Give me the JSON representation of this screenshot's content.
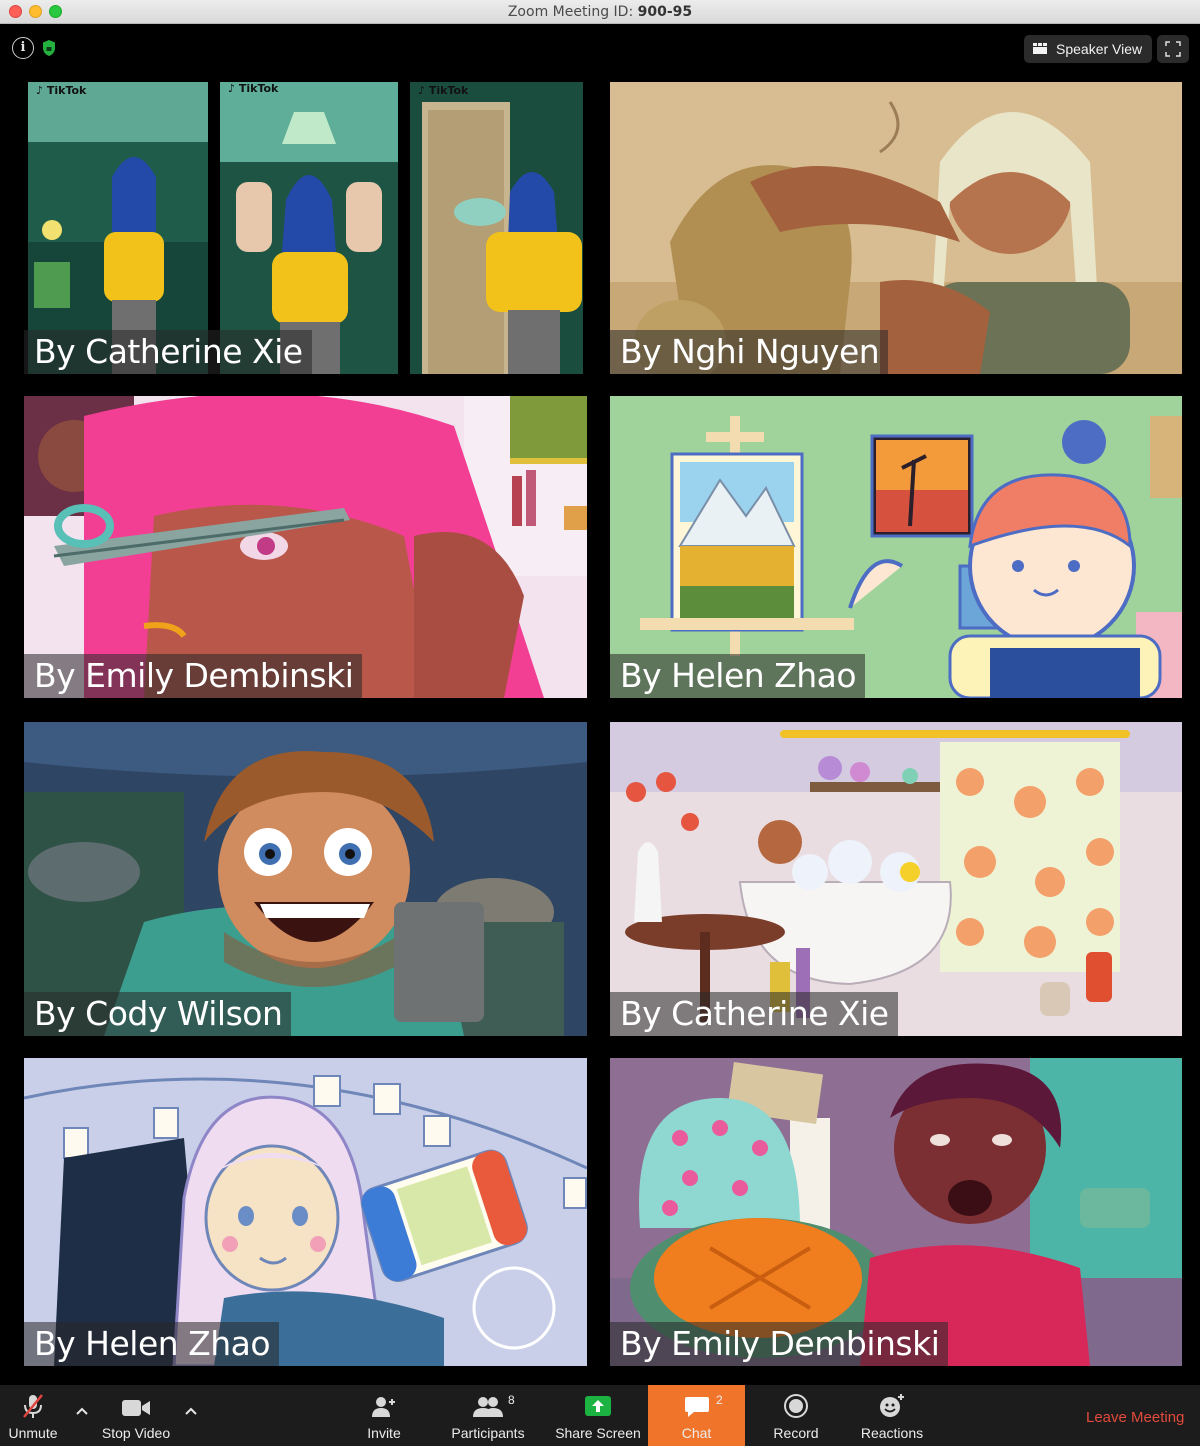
{
  "window": {
    "title_prefix": "Zoom Meeting ID: ",
    "meeting_id": "900-95"
  },
  "topbar": {
    "info_icon": "info-icon",
    "security_icon": "shield-icon",
    "view_label": "Speaker View",
    "fullscreen_icon": "fullscreen-icon"
  },
  "gallery": {
    "tiles": [
      {
        "label": "By Catherine Xie"
      },
      {
        "label": "By Nghi Nguyen"
      },
      {
        "label": "By Emily Dembinski"
      },
      {
        "label": "By Helen Zhao"
      },
      {
        "label": "By Cody Wilson"
      },
      {
        "label": "By Catherine Xie"
      },
      {
        "label": "By Helen Zhao"
      },
      {
        "label": "By Emily Dembinski"
      }
    ],
    "tiktok_label": "TikTok"
  },
  "toolbar": {
    "unmute": "Unmute",
    "stop_video": "Stop Video",
    "invite": "Invite",
    "participants": "Participants",
    "participants_count": "8",
    "share_screen": "Share Screen",
    "chat": "Chat",
    "chat_count": "2",
    "record": "Record",
    "reactions": "Reactions",
    "leave": "Leave Meeting"
  },
  "colors": {
    "chat_active": "#f0752a",
    "leave": "#e24a3b",
    "share_green": "#1db342"
  }
}
